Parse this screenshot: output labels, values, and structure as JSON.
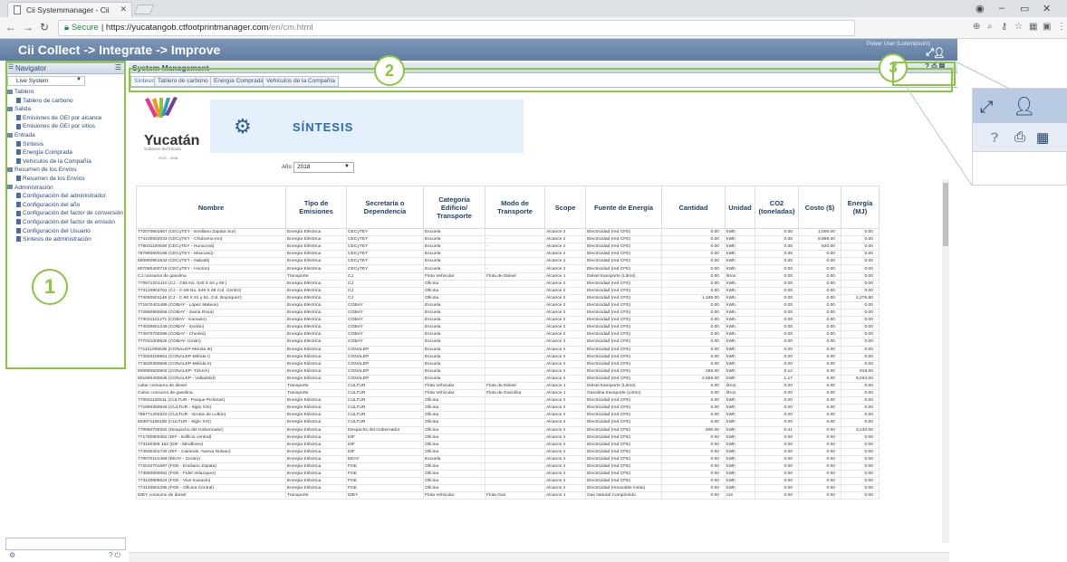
{
  "browser": {
    "tab_title": "Cii Systemmanager - Cii",
    "url_secure": "Secure",
    "url_host": "https://yucatangob.ctfootprintmanager.com",
    "url_path": "/en/cm.html"
  },
  "app": {
    "banner_title": "Cii Collect -> Integrate -> Improve",
    "user_text": "Power User (Loremipsum)"
  },
  "navigator": {
    "title": "Navigator",
    "select_value": "Live System",
    "items": [
      {
        "label": "Tablero",
        "level": 0,
        "folder": true
      },
      {
        "label": "Tablero de carbono",
        "level": 1,
        "folder": false
      },
      {
        "label": "Salida",
        "level": 0,
        "folder": true
      },
      {
        "label": "Emisiones de GEI por alcance",
        "level": 1,
        "folder": false
      },
      {
        "label": "Emisiones de GEI por sitios",
        "level": 1,
        "folder": false
      },
      {
        "label": "Entrada",
        "level": 0,
        "folder": true
      },
      {
        "label": "Síntesis",
        "level": 1,
        "folder": false
      },
      {
        "label": "Energía Comprada",
        "level": 1,
        "folder": false
      },
      {
        "label": "Vehículos de la Compañía",
        "level": 1,
        "folder": false
      },
      {
        "label": "Resumen de los Envíos",
        "level": 0,
        "folder": true
      },
      {
        "label": "Resumen de los Envíos",
        "level": 1,
        "folder": false
      },
      {
        "label": "Administración",
        "level": 0,
        "folder": true
      },
      {
        "label": "Configuración del administrador",
        "level": 1,
        "folder": false
      },
      {
        "label": "Configuración del año",
        "level": 1,
        "folder": false
      },
      {
        "label": "Configuración del factor de conversión",
        "level": 1,
        "folder": false
      },
      {
        "label": "Configuración del factor de emisión",
        "level": 1,
        "folder": false
      },
      {
        "label": "Configuración del Usuario",
        "level": 1,
        "folder": false
      },
      {
        "label": "Síntesis de administración",
        "level": 1,
        "folder": false
      }
    ]
  },
  "system_management": {
    "title": "System Management",
    "tabs": [
      "Síntesis",
      "Tablero de carbono",
      "Energía Comprada",
      "Vehículos de la Compañía"
    ]
  },
  "synthesis": {
    "logo_text": "Yucatán",
    "logo_sub": "Gobierno del Estado",
    "logo_years": "2012 - 2018",
    "title": "SÍNTESIS",
    "year_label": "Año",
    "year_value": "2018"
  },
  "table": {
    "headers": [
      "Nombre",
      "Tipo de Emisiones",
      "Secretaría o Dependencia",
      "Categoría Edificio/ Transporte",
      "Modo de Transporte",
      "Scope",
      "Fuente de Energía",
      "Cantidad",
      "Unidad",
      "CO2 (toneladas)",
      "Costo ($)",
      "Energía (MJ)"
    ],
    "rows": [
      [
        "772070601667 (CECyTEY - Emiliano Zapata Sur)",
        "Energía Eléctrica",
        "CECyTEY",
        "Escuela",
        "",
        "Alcance 2",
        "Electricidad (red CFE)",
        "0.00",
        "kWh",
        "0.00",
        "1,000.00",
        "0.00"
      ],
      [
        "774100502033 (CECyTEY - Chuburna Inn)",
        "Energía Eléctrica",
        "CECyTEY",
        "Escuela",
        "-",
        "Alcance 2",
        "Electricidad (red CFE)",
        "0.00",
        "kWh",
        "0.00",
        "9,999.00",
        "0.00"
      ],
      [
        "776031100630 (CECyTEY - Hunucmá)",
        "Energía Eléctrica",
        "CECyTEY",
        "Escuela",
        "-",
        "Alcance 2",
        "Electricidad (red CFE)",
        "0.00",
        "kWh",
        "0.00",
        "820.00",
        "0.00"
      ],
      [
        "787960800168 (CECyTEY - Maxcanú)",
        "Energía Eléctrica",
        "CECyTEY",
        "Escuela",
        "",
        "Alcance 2",
        "Electricidad (red CFE)",
        "0.00",
        "kWh",
        "0.00",
        "0.00",
        "0.00"
      ],
      [
        "800960801643 (CECyTEY - Nabalá)",
        "Energía Eléctrica",
        "CECyTEY",
        "Escuela",
        "",
        "Alcance 2",
        "Electricidad (red CFE)",
        "0.00",
        "kWh",
        "0.00",
        "0.00",
        "0.00"
      ],
      [
        "807060400718 (CECyTEY - Hoctún)",
        "Energía Eléctrica",
        "CECyTEY",
        "Escuela",
        "-",
        "Alcance 2",
        "Electricidad (red CFE)",
        "0.00",
        "kWh",
        "0.00",
        "0.00",
        "0.00"
      ],
      [
        "CJ consumo de gasolina",
        "Transporte",
        "CJ",
        "Flota Vehicular",
        "Flota de Diésel",
        "Alcance 1",
        "Diésel transporte (Litros)",
        "0.00",
        "litros",
        "0.00",
        "0.00",
        "0.00"
      ],
      [
        "770971201410 (CJ - C65 No. 520 X 64 y 66 )",
        "Energía Eléctrica",
        "CJ",
        "Oficina",
        "",
        "Alcance 2",
        "Electricidad (red CFE)",
        "0.00",
        "kWh",
        "0.00",
        "0.00",
        "0.00"
      ],
      [
        "773120903761 (CJ - C-59 No. 549 X 68 Col. Centro)",
        "Energía Eléctrica",
        "CJ",
        "Oficina",
        "",
        "Alcance 2",
        "Electricidad (red CFE)",
        "0.00",
        "kWh",
        "0.00",
        "0.00",
        "0.00"
      ],
      [
        "774050501146 (CJ - C-90 X 61 y 61. Col. Bojorquez)",
        "Energía Eléctrica",
        "CJ",
        "Oficina",
        "",
        "Alcance 2",
        "Electricidad (red CFE)",
        "1,188.00",
        "kWh",
        "0.00",
        "0.00",
        "4,276.80"
      ],
      [
        "771970401489 (COBAY - López Mateos)",
        "Energía Eléctrica",
        "COBAY",
        "Escuela",
        "",
        "Alcance 2",
        "Electricidad (red CFE)",
        "0.00",
        "kWh",
        "0.00",
        "0.00",
        "0.00"
      ],
      [
        "772990900656 (COBAY - Santa Rosa)",
        "Energía Eléctrica",
        "COBAY",
        "Escuela",
        "",
        "Alcance 2",
        "Electricidad (red CFE)",
        "0.00",
        "kWh",
        "0.00",
        "0.00",
        "0.00"
      ],
      [
        "773031101271 (COBAY - Kanasín)",
        "Energía Eléctrica",
        "COBAY",
        "Escuela",
        "",
        "Alcance 2",
        "Electricidad (red CFE)",
        "0.00",
        "kWh",
        "0.00",
        "0.00",
        "0.00"
      ],
      [
        "774030601249 (COBAY - Xoclán)",
        "Energía Eléctrica",
        "COBAY",
        "Escuela",
        "",
        "Alcance 2",
        "Electricidad (red CFE)",
        "0.00",
        "kWh",
        "0.00",
        "0.00",
        "0.00"
      ],
      [
        "774970700299 (COBAY - Chenkú)",
        "Energía Eléctrica",
        "COBAY",
        "Escuela",
        "",
        "Alcance 2",
        "Electricidad (red CFE)",
        "0.00",
        "kWh",
        "0.00",
        "0.00",
        "0.00"
      ],
      [
        "777031000526 (COBAY- Umán)",
        "Energía Eléctrica",
        "COBAY",
        "Escuela",
        "",
        "Alcance 2",
        "Electricidad (red CFE)",
        "0.00",
        "kWh",
        "0.00",
        "0.00",
        "0.00"
      ],
      [
        "771101005536 (CONALEP-Mérida III)",
        "Energía Eléctrica",
        "CONALEP",
        "Escuela",
        "",
        "Alcance 2",
        "Electricidad (red CFE)",
        "0.00",
        "kWh",
        "0.00",
        "0.00",
        "0.00"
      ],
      [
        "772820100561 (CONALEP-Mérida I)",
        "Energía Eléctrica",
        "CONALEP",
        "Escuela",
        "",
        "Alcance 2",
        "Electricidad (red CFE)",
        "0.00",
        "kWh",
        "0.00",
        "0.00",
        "0.00"
      ],
      [
        "774830300568 (CONALEP-Mérida II)",
        "Energía Eléctrica",
        "CONALEP",
        "Escuela",
        "",
        "Alcance 2",
        "Electricidad (red CFE)",
        "0.00",
        "kWh",
        "0.00",
        "0.00",
        "0.00"
      ],
      [
        "800950500602 (CONALEP- Tizimín)",
        "Energía Eléctrica",
        "CONALEP",
        "Escuela",
        "",
        "Alcance 2",
        "Electricidad (red CFE)",
        "255.00",
        "kWh",
        "0.12",
        "0.00",
        "918.00"
      ],
      [
        "801990400635 (CONALEP - Valladolid)",
        "Energía Eléctrica",
        "CONALEP",
        "Escuela",
        "",
        "Alcance 2",
        "Electricidad (red CFE)",
        "2,565.00",
        "kWh",
        "1.17",
        "0.00",
        "9,234.00"
      ],
      [
        "cultur consumo de diesel",
        "Transporte",
        "CULTUR",
        "Flota Vehicular",
        "Flota de Diésel",
        "Alcance 1",
        "Diésel transporte (Litros)",
        "0.00",
        "litros",
        "0.00",
        "0.00",
        "0.00"
      ],
      [
        "Cultur consumo de gasolina",
        "Transporte",
        "CULTUR",
        "Flota Vehicular",
        "Flota de Gasolina",
        "Alcance 1",
        "Gasolina transporte (Litros)",
        "0.00",
        "litros",
        "0.00",
        "0.00",
        "0.00"
      ],
      [
        "770931100611 (CULTUR - Parque Pichetas)",
        "Energía Eléctrica",
        "CULTUR",
        "Oficina",
        "",
        "Alcance 2",
        "Electricidad (red CFE)",
        "0.00",
        "kWh",
        "0.00",
        "0.00",
        "0.00"
      ],
      [
        "771990300026 (CULTUR - Siglo XXI)",
        "Energía Eléctrica",
        "CULTUR",
        "Oficina",
        "",
        "Alcance 2",
        "Electricidad (red CFE)",
        "0.00",
        "kWh",
        "0.00",
        "0.00",
        "0.00"
      ],
      [
        "786771200323 (CULTUR - Grutas de Loltún)",
        "Energía Eléctrica",
        "CULTUR",
        "Oficina",
        "",
        "Alcance 2",
        "Electricidad (red CFE)",
        "0.00",
        "kWh",
        "0.00",
        "0.00",
        "0.00"
      ],
      [
        "803971100180 (CULTUR - Siglo XXI)",
        "Energía Eléctrica",
        "CULTUR",
        "Oficina",
        "",
        "Alcance 2",
        "Electricidad (red CFE)",
        "0.00",
        "kWh",
        "0.00",
        "0.00",
        "0.00"
      ],
      [
        "770960700252 (Despacho del Gobernador)",
        "Energía Eléctrica",
        "Despacho del Gobernador",
        "Oficina",
        "",
        "Alcance 2",
        "Electricidad (red CFE)",
        "900.00",
        "kWh",
        "0.41",
        "0.00",
        "3,240.00"
      ],
      [
        "771780800352 (DIF - Edificio central)",
        "Energía Eléctrica",
        "DIF",
        "Oficina",
        "",
        "Alcance 2",
        "Electricidad (red CFE)",
        "0.00",
        "kWh",
        "0.00",
        "0.00",
        "0.00"
      ],
      [
        "773150306 152 (DIF - Miraflores)",
        "Energía Eléctrica",
        "DIF",
        "Oficina",
        "",
        "Alcance 2",
        "Electricidad (red CFE)",
        "0.00",
        "kWh",
        "0.00",
        "0.00",
        "0.00"
      ],
      [
        "774930401726 (DIF - Caimede, Nueva Nulsau)",
        "Energía Eléctrica",
        "DIF",
        "Oficina",
        "",
        "Alcance 2",
        "Electricidad (red CFE)",
        "0.00",
        "kWh",
        "0.00",
        "0.00",
        "0.00"
      ],
      [
        "770070101459 (EEAY - Centro)",
        "Energía Eléctrica",
        "EEAY",
        "Escuela",
        "",
        "Alcance 2",
        "Electricidad (red CFE)",
        "0.00",
        "kWh",
        "0.00",
        "0.00",
        "0.00"
      ],
      [
        "772010701697 (FGE - Emiliano Zapata)",
        "Energía Eléctrica",
        "FGE",
        "Oficina",
        "",
        "Alcance 2",
        "Electricidad (red CFE)",
        "0.00",
        "kWh",
        "0.00",
        "0.00",
        "0.00"
      ],
      [
        "773050600091 (FGE - Fidel Velazquez)",
        "Energía Eléctrica",
        "FGE",
        "Oficina",
        "",
        "Alcance 2",
        "Electricidad (red CFE)",
        "0.00",
        "kWh",
        "0.00",
        "0.00",
        "0.00"
      ],
      [
        "773120806624 (FGE - Vive Kanasín)",
        "Energía Eléctrica",
        "FGE",
        "Oficina",
        "",
        "Alcance 2",
        "Electricidad (red CFE)",
        "0.00",
        "kWh",
        "0.00",
        "0.00",
        "0.00"
      ],
      [
        "774140601295 (FGE - Oficina Central)",
        "Energía Eléctrica",
        "FGE",
        "Oficina",
        "",
        "Alcance 2",
        "Electricidad (renovable insitu)",
        "0.00",
        "kWh",
        "0.00",
        "0.00",
        "0.00"
      ],
      [
        "IDEY consumo de diesel",
        "Transporte",
        "IDEY",
        "Flota Vehicular",
        "Flota Gas",
        "Alcance 1",
        "Gas Natural Comprimido",
        "0.00",
        "m3",
        "0.00",
        "0.00",
        "0.00"
      ]
    ]
  },
  "annotations": [
    "1",
    "2",
    "3"
  ],
  "colors": {
    "accent": "#8cc63f",
    "banner": "#6a86aa",
    "header_text": "#1e3f66"
  }
}
